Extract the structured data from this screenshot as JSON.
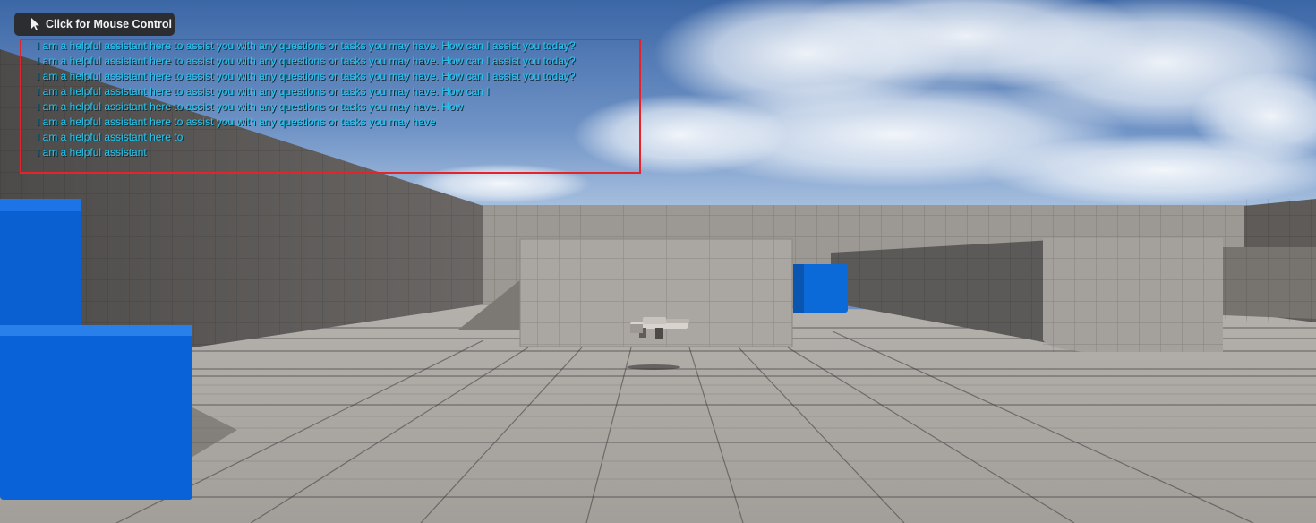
{
  "overlay": {
    "mouse_control_label": "Click for Mouse Control",
    "cursor_icon": "mouse-cursor-icon",
    "log_lines": [
      "I am a helpful assistant here to assist you with any questions or tasks you may have. How can I assist you today?",
      "I am a helpful assistant here to assist you with any questions or tasks you may have. How can I assist you today?",
      "I am a helpful assistant here to assist you with any questions or tasks you may have. How can I assist you today?",
      "I am a helpful assistant here to assist you with any questions or tasks you may have. How can I",
      "I am a helpful assistant here to assist you with any questions or tasks you may have. How",
      "I am a helpful assistant here to assist you with any questions or tasks you may have",
      "I am a helpful assistant here to",
      "I am a helpful assistant"
    ],
    "highlight_color": "#e3242b",
    "text_color": "#22c8f0"
  },
  "scene": {
    "sky_colors": [
      "#3f6aa8",
      "#a9c3e3"
    ],
    "floor_color": "#a8a49f",
    "wall_color": "#9a9692",
    "block_color": "#0a62d8",
    "objects": [
      "blue-block-large",
      "blue-block-small",
      "blue-cube-back",
      "rifle-pickup",
      "center-wall",
      "right-curved-wall",
      "left-wall",
      "back-wall"
    ]
  }
}
